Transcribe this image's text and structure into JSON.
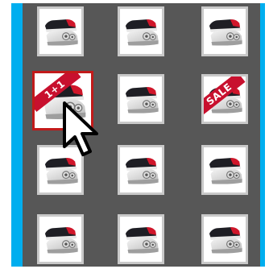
{
  "grid": {
    "columns": 3,
    "rows": 4,
    "items": [
      {
        "name": "shoe-tile-1",
        "badge": ""
      },
      {
        "name": "shoe-tile-2",
        "badge": ""
      },
      {
        "name": "shoe-tile-3",
        "badge": ""
      },
      {
        "name": "shoe-tile-4",
        "badge": "1+1",
        "selected": true
      },
      {
        "name": "shoe-tile-5",
        "badge": ""
      },
      {
        "name": "shoe-tile-6",
        "badge": "SALE"
      },
      {
        "name": "shoe-tile-7",
        "badge": ""
      },
      {
        "name": "shoe-tile-8",
        "badge": ""
      },
      {
        "name": "shoe-tile-9",
        "badge": ""
      },
      {
        "name": "shoe-tile-10",
        "badge": ""
      },
      {
        "name": "shoe-tile-11",
        "badge": ""
      },
      {
        "name": "shoe-tile-12",
        "badge": ""
      }
    ]
  },
  "colors": {
    "grid_background": "#575757",
    "side_bars": "#00aeef",
    "selection_border": "#c21a1a",
    "badge": "#c8102e"
  },
  "icons": {
    "product_image": "sneaker-icon",
    "pointer": "mouse-cursor-icon"
  }
}
